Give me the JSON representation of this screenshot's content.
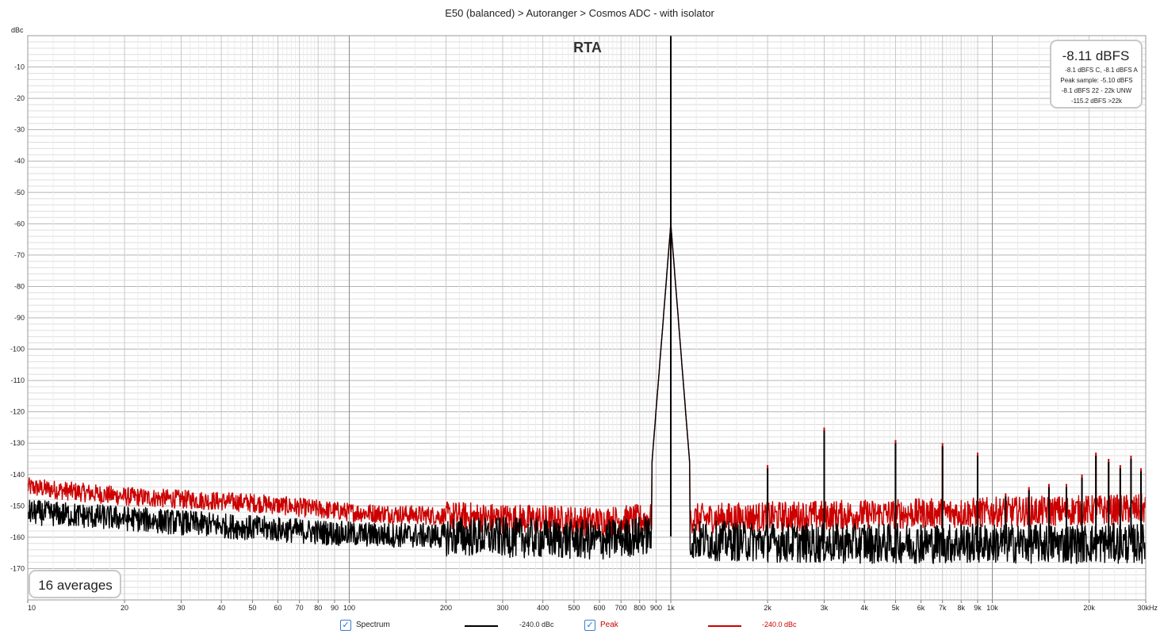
{
  "chart_data": {
    "type": "line",
    "title": "E50 (balanced) > Autoranger > Cosmos ADC - with isolator",
    "overlay_label": "RTA",
    "ylabel": "dBc",
    "xscale": "log",
    "xlim": [
      10,
      30000
    ],
    "ylim": [
      -180,
      0
    ],
    "grid": true,
    "x_ticks": [
      {
        "v": 10,
        "t": "10"
      },
      {
        "v": 20,
        "t": "20"
      },
      {
        "v": 30,
        "t": "30"
      },
      {
        "v": 40,
        "t": "40"
      },
      {
        "v": 50,
        "t": "50"
      },
      {
        "v": 60,
        "t": "60"
      },
      {
        "v": 70,
        "t": "70"
      },
      {
        "v": 80,
        "t": "80"
      },
      {
        "v": 90,
        "t": "90"
      },
      {
        "v": 100,
        "t": "100"
      },
      {
        "v": 200,
        "t": "200"
      },
      {
        "v": 300,
        "t": "300"
      },
      {
        "v": 400,
        "t": "400"
      },
      {
        "v": 500,
        "t": "500"
      },
      {
        "v": 600,
        "t": "600"
      },
      {
        "v": 700,
        "t": "700"
      },
      {
        "v": 800,
        "t": "800"
      },
      {
        "v": 900,
        "t": "900"
      },
      {
        "v": 1000,
        "t": "1k"
      },
      {
        "v": 2000,
        "t": "2k"
      },
      {
        "v": 3000,
        "t": "3k"
      },
      {
        "v": 4000,
        "t": "4k"
      },
      {
        "v": 5000,
        "t": "5k"
      },
      {
        "v": 6000,
        "t": "6k"
      },
      {
        "v": 7000,
        "t": "7k"
      },
      {
        "v": 8000,
        "t": "8k"
      },
      {
        "v": 9000,
        "t": "9k"
      },
      {
        "v": 10000,
        "t": "10k"
      },
      {
        "v": 20000,
        "t": "20k"
      },
      {
        "v": 30000,
        "t": "30kHz"
      }
    ],
    "y_ticks": [
      {
        "v": -10,
        "t": "-10"
      },
      {
        "v": -20,
        "t": "-20"
      },
      {
        "v": -30,
        "t": "-30"
      },
      {
        "v": -40,
        "t": "-40"
      },
      {
        "v": -50,
        "t": "-50"
      },
      {
        "v": -60,
        "t": "-60"
      },
      {
        "v": -70,
        "t": "-70"
      },
      {
        "v": -80,
        "t": "-80"
      },
      {
        "v": -90,
        "t": "-90"
      },
      {
        "v": -100,
        "t": "-100"
      },
      {
        "v": -110,
        "t": "-110"
      },
      {
        "v": -120,
        "t": "-120"
      },
      {
        "v": -130,
        "t": "-130"
      },
      {
        "v": -140,
        "t": "-140"
      },
      {
        "v": -150,
        "t": "-150"
      },
      {
        "v": -160,
        "t": "-160"
      },
      {
        "v": -170,
        "t": "-170"
      }
    ],
    "series": [
      {
        "name": "Spectrum",
        "color": "#000000",
        "legend_value": "-240.0 dBc",
        "floor": [
          [
            10,
            -152
          ],
          [
            20,
            -154
          ],
          [
            50,
            -157
          ],
          [
            100,
            -159
          ],
          [
            300,
            -160
          ],
          [
            600,
            -161
          ],
          [
            900,
            -159
          ],
          [
            1200,
            -161
          ],
          [
            3000,
            -162
          ],
          [
            10000,
            -162
          ],
          [
            30000,
            -162
          ]
        ],
        "noise_amplitude": 4,
        "peaks": [
          [
            1000,
            0
          ],
          [
            2000,
            -138
          ],
          [
            3000,
            -126
          ],
          [
            4000,
            -156
          ],
          [
            5000,
            -130
          ],
          [
            6000,
            -156
          ],
          [
            7000,
            -131
          ],
          [
            8000,
            -156
          ],
          [
            9000,
            -134
          ],
          [
            11000,
            -147
          ],
          [
            13000,
            -145
          ],
          [
            15000,
            -144
          ],
          [
            17000,
            -144
          ],
          [
            19000,
            -141
          ],
          [
            21000,
            -134
          ],
          [
            23000,
            -136
          ],
          [
            25000,
            -138
          ],
          [
            27000,
            -135
          ],
          [
            29000,
            -139
          ]
        ]
      },
      {
        "name": "Peak",
        "color": "#cc0000",
        "legend_value": "-240.0 dBc",
        "floor": [
          [
            10,
            -144
          ],
          [
            20,
            -147
          ],
          [
            50,
            -149
          ],
          [
            100,
            -152
          ],
          [
            300,
            -154
          ],
          [
            600,
            -155
          ],
          [
            900,
            -154
          ],
          [
            1200,
            -154
          ],
          [
            3000,
            -153
          ],
          [
            10000,
            -152
          ],
          [
            30000,
            -151
          ]
        ],
        "noise_amplitude": 3,
        "peaks": [
          [
            1000,
            0
          ],
          [
            2000,
            -137
          ],
          [
            3000,
            -125
          ],
          [
            4000,
            -150
          ],
          [
            5000,
            -129
          ],
          [
            6000,
            -150
          ],
          [
            7000,
            -130
          ],
          [
            8000,
            -150
          ],
          [
            9000,
            -133
          ],
          [
            11000,
            -146
          ],
          [
            13000,
            -144
          ],
          [
            15000,
            -143
          ],
          [
            17000,
            -143
          ],
          [
            19000,
            -140
          ],
          [
            21000,
            -133
          ],
          [
            23000,
            -135
          ],
          [
            25000,
            -137
          ],
          [
            27000,
            -134
          ],
          [
            29000,
            -138
          ]
        ]
      }
    ]
  },
  "readout": {
    "main": "-8.11 dBFS",
    "lines": [
      "-8.1 dBFS C, -8.1 dBFS A",
      "Peak sample: -5.10 dBFS",
      "-8.1 dBFS 22 - 22k UNW",
      "-115.2 dBFS >22k"
    ]
  },
  "averages_label": "16 averages",
  "legend": [
    {
      "label": "Spectrum",
      "value": "-240.0 dBc",
      "color": "#000000",
      "checked": true
    },
    {
      "label": "Peak",
      "value": "-240.0 dBc",
      "color": "#cc0000",
      "checked": true
    }
  ]
}
